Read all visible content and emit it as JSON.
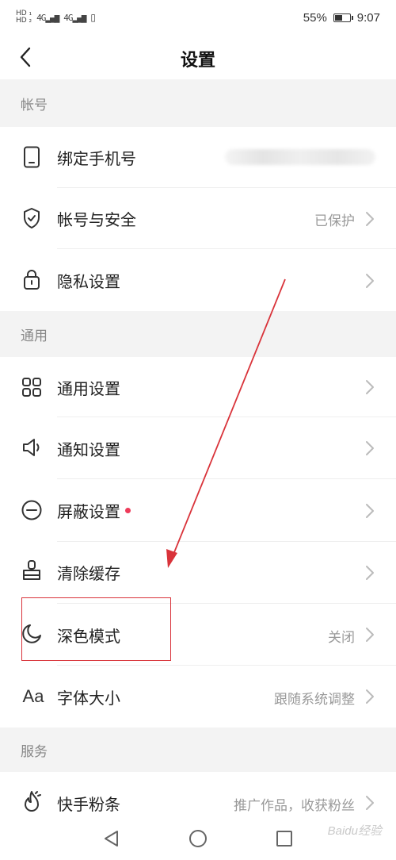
{
  "status_bar": {
    "network": "4G",
    "battery_percent": "55%",
    "battery_level": 55,
    "time": "9:07"
  },
  "nav": {
    "title": "设置"
  },
  "sections": {
    "account": {
      "header": "帐号"
    },
    "general": {
      "header": "通用"
    },
    "service": {
      "header": "服务"
    }
  },
  "rows": {
    "bind_phone": {
      "label": "绑定手机号"
    },
    "account_security": {
      "label": "帐号与安全",
      "value": "已保护"
    },
    "privacy": {
      "label": "隐私设置"
    },
    "general_settings": {
      "label": "通用设置"
    },
    "notifications": {
      "label": "通知设置"
    },
    "block": {
      "label": "屏蔽设置"
    },
    "clear_cache": {
      "label": "清除缓存"
    },
    "dark_mode": {
      "label": "深色模式",
      "value": "关闭"
    },
    "font_size": {
      "icon_text": "Aa",
      "label": "字体大小",
      "value": "跟随系统调整"
    },
    "kuaishou_fans": {
      "label": "快手粉条",
      "value": "推广作品，收获粉丝"
    }
  },
  "watermark": "Baidu经验",
  "colors": {
    "accent_red": "#d9333a",
    "dot_red": "#ee3b5a",
    "section_bg": "#f3f3f3",
    "muted_text": "#999999"
  }
}
